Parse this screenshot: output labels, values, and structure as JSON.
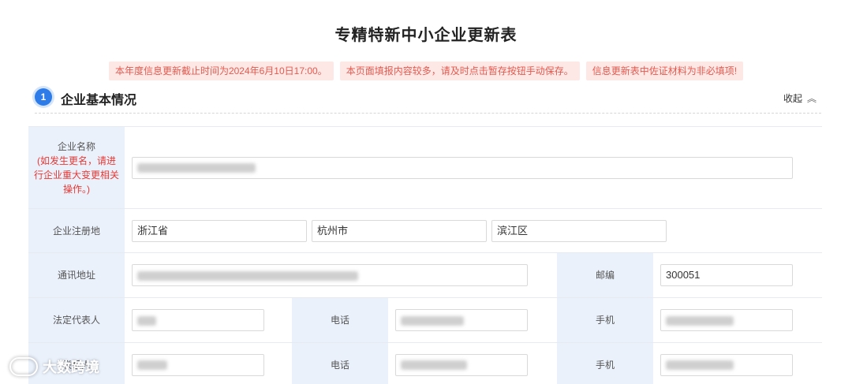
{
  "page": {
    "title": "专精特新中小企业更新表"
  },
  "notices": [
    "本年度信息更新截止时间为2024年6月10日17:00。",
    "本页面填报内容较多，请及时点击暂存按钮手动保存。",
    "信息更新表中佐证材料为非必填项!"
  ],
  "section": {
    "number": "1",
    "title": "企业基本情况",
    "collapse_label": "收起",
    "collapse_icon": "double-chevron-up-icon"
  },
  "form": {
    "company_name": {
      "label": "企业名称",
      "note": "(如发生更名，请进行企业重大变更相关操作。)",
      "value_hidden": true
    },
    "registered_address": {
      "label": "企业注册地",
      "province": "浙江省",
      "city": "杭州市",
      "district": "滨江区"
    },
    "mailing_address": {
      "label": "通讯地址",
      "postcode_label": "邮编",
      "postcode": "300051"
    },
    "legal_rep": {
      "label": "法定代表人",
      "phone_label": "电话",
      "mobile_label": "手机"
    },
    "contact": {
      "label": "联系人",
      "phone_label": "电话",
      "mobile_label": "手机"
    }
  },
  "watermark": {
    "text": "大数跨境"
  },
  "colors": {
    "accent": "#2d7be8",
    "label_bg": "#eaf1fb",
    "notice_bg": "#fde8e6",
    "notice_text": "#e35a4f",
    "required_red": "#e53935"
  }
}
